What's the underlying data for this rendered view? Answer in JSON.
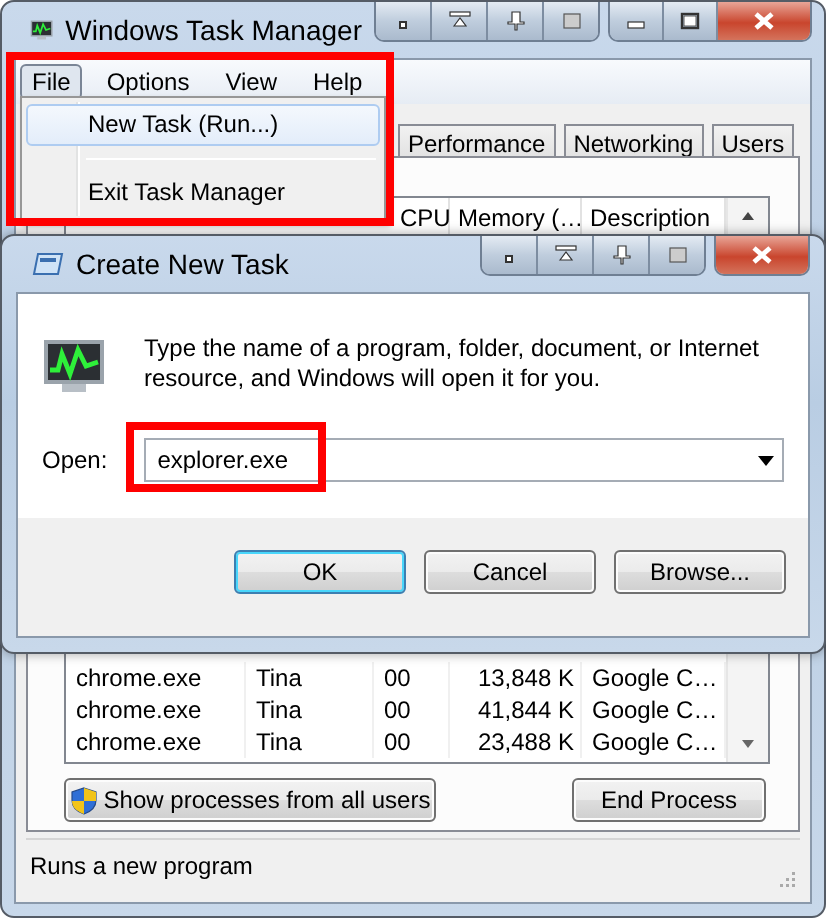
{
  "task_manager": {
    "title": "Windows Task Manager",
    "menu": [
      {
        "label": "File",
        "selected": true
      },
      {
        "label": "Options",
        "selected": false
      },
      {
        "label": "View",
        "selected": false
      },
      {
        "label": "Help",
        "selected": false
      }
    ],
    "tabs": [
      {
        "label": "Performance",
        "selected": false
      },
      {
        "label": "Networking",
        "selected": false
      },
      {
        "label": "Users",
        "selected": false
      }
    ],
    "columns": [
      "CPU",
      "Memory (…",
      "Description"
    ],
    "rows": [
      {
        "image": "chrome.exe",
        "user": "Tina",
        "cpu": "00",
        "memory": "13,848 K",
        "description": "Google C…"
      },
      {
        "image": "chrome.exe",
        "user": "Tina",
        "cpu": "00",
        "memory": "41,844 K",
        "description": "Google C…"
      },
      {
        "image": "chrome.exe",
        "user": "Tina",
        "cpu": "00",
        "memory": "23,488 K",
        "description": "Google C…"
      }
    ],
    "buttons": [
      "Show processes from all users",
      "End Process"
    ],
    "status": "Runs a new program"
  },
  "file_menu": {
    "items": [
      {
        "label": "New Task (Run...)",
        "selected": true
      },
      {
        "label": "Exit Task Manager",
        "selected": false
      }
    ]
  },
  "dialog": {
    "title": "Create New Task",
    "message": "Type the name of a program, folder, document, or Internet resource, and Windows will open it for you.",
    "open_label": "Open:",
    "open_value": "explorer.exe",
    "buttons": [
      {
        "label": "OK",
        "default": true
      },
      {
        "label": "Cancel",
        "default": false
      },
      {
        "label": "Browse...",
        "default": false
      }
    ]
  }
}
